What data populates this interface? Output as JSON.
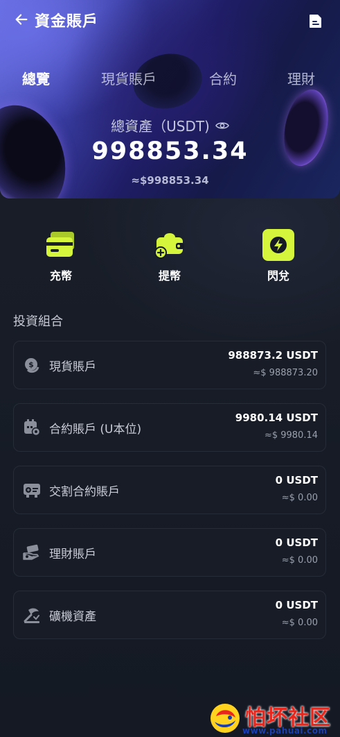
{
  "header": {
    "title": "資金賬戶",
    "back_icon": "arrow-left-icon",
    "right_icon": "document-icon"
  },
  "tabs": [
    {
      "label": "總覽",
      "active": true
    },
    {
      "label": "現貨賬戶",
      "active": false
    },
    {
      "label": "合約",
      "active": false
    },
    {
      "label": "理財",
      "active": false
    }
  ],
  "summary": {
    "label": "總資產（USDT)",
    "value": "998853.34",
    "approx": "≈$998853.34",
    "eye_icon": "eye-icon"
  },
  "actions": [
    {
      "label": "充幣",
      "icon": "card-icon"
    },
    {
      "label": "提幣",
      "icon": "wallet-plus-icon"
    },
    {
      "label": "閃兌",
      "icon": "lightning-icon"
    }
  ],
  "portfolio": {
    "title": "投資組合",
    "accounts": [
      {
        "name": "現貨賬戶",
        "amount": "988873.2 USDT",
        "approx": "≈$ 988873.20",
        "icon": "coins-icon"
      },
      {
        "name": "合約賬戶 (U本位)",
        "amount": "9980.14 USDT",
        "approx": "≈$ 9980.14",
        "icon": "calendar-gear-icon"
      },
      {
        "name": "交割合約賬戶",
        "amount": "0 USDT",
        "approx": "≈$ 0.00",
        "icon": "delivery-icon"
      },
      {
        "name": "理財賬戶",
        "amount": "0 USDT",
        "approx": "≈$ 0.00",
        "icon": "hand-money-icon"
      },
      {
        "name": "礦機資產",
        "amount": "0 USDT",
        "approx": "≈$ 0.00",
        "icon": "mining-icon"
      }
    ]
  },
  "watermark": {
    "text": "怕坏社区",
    "url": "www.pahuai.com"
  },
  "colors": {
    "accent": "#d4f53c",
    "background": "#151a24",
    "card_border": "#262c38"
  }
}
